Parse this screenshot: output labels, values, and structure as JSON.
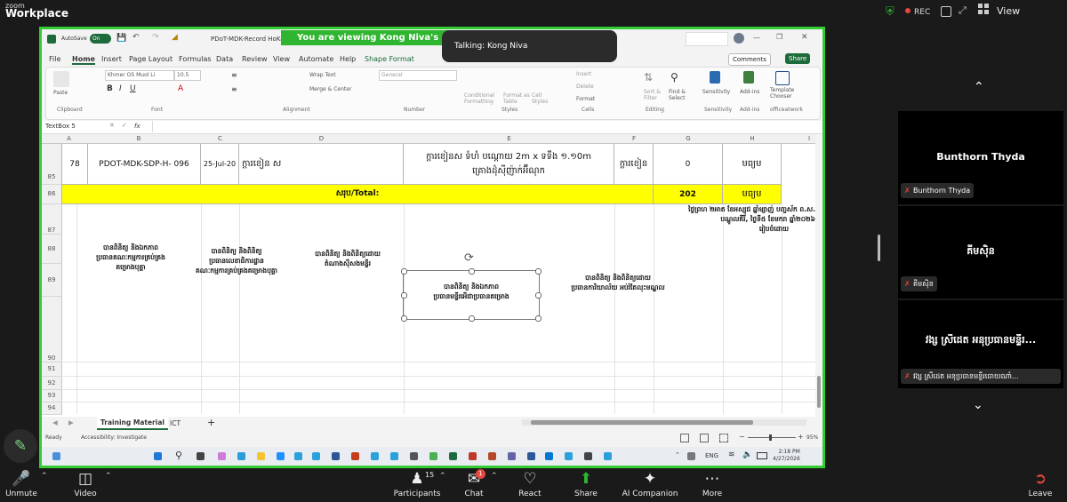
{
  "zoom": {
    "brand_small": "zoom",
    "brand": "Workplace",
    "rec_label": "REC",
    "view_label": "View",
    "viewing_banner": "You are viewing  Kong Niva's screen",
    "talking": "Talking: Kong Niva"
  },
  "excel": {
    "autosave": "AutoSave",
    "autosave_state": "On",
    "file_title": "PDoT-MDK-Record HoKa...",
    "menu": [
      "File",
      "Home",
      "Insert",
      "Page Layout",
      "Formulas",
      "Data",
      "Review",
      "View",
      "Automate",
      "Help",
      "Shape Format"
    ],
    "comments": "Comments",
    "share": "Share",
    "ribbon": {
      "paste": "Paste",
      "clipboard": "Clipboard",
      "font_name": "Khmer OS Muol Li",
      "font_size": "10.5",
      "font": "Font",
      "wrap_text": "Wrap Text",
      "merge_center": "Merge & Center",
      "alignment": "Alignment",
      "number_format": "General",
      "number": "Number",
      "conditional": "Conditional Formatting",
      "format_table": "Format as Table",
      "cell_styles": "Cell Styles",
      "styles": "Styles",
      "insert": "Insert",
      "delete": "Delete",
      "format": "Format",
      "cells": "Cells",
      "sort_filter": "Sort & Filter",
      "find_select": "Find & Select",
      "editing": "Editing",
      "sensitivity": "Sensitivity",
      "addins": "Add-ins",
      "template": "Template Chooser",
      "officeatwork": "officeatwork"
    },
    "name_box": "TextBox 5",
    "fx": "fx",
    "columns": [
      "A",
      "B",
      "C",
      "D",
      "E",
      "F",
      "G",
      "H",
      "I"
    ],
    "rows": [
      "85",
      "86",
      "87",
      "88",
      "89",
      "90",
      "91",
      "92",
      "93",
      "94"
    ],
    "row85": {
      "no": "78",
      "code": "PDOT-MDK-SDP-H- 096",
      "date": "25-Jul-20",
      "item": "ក្តារខៀន ស",
      "desc_line1": "ក្តារខៀនស ទំហំ បណ្តោយ 2m x ទទឹង ១.១0m",
      "desc_line2": "គ្រោងដុំស៊ីញ៉ាក់អ៊ីណុក",
      "unit": "ក្តារខៀន",
      "qty": "0",
      "status": "មធ្យម"
    },
    "row86": {
      "label": "សរុប/Total:",
      "total": "202",
      "status": "មធ្យម"
    },
    "signatures": {
      "date_line1": "ថ្ងៃ​ព្រហ ២អាត ខែអស្សុជ ឆ្នាំម្សាញ់ បញ្ចស័ក ព.ស.",
      "date_line2": "បណ្តូលគីរី, ថ្ងៃទី៥ ខែមករា ឆ្នាំ២០២៦",
      "date_line3": "រៀបចំដោយ",
      "s1_line1": "បានពិនិត្យ និងឯកភាព",
      "s1_line2": "ប្រធានគណៈកម្មការគ្រប់គ្រង",
      "s1_line3": "គម្រោងបុគ្គា",
      "s2_line1": "បានពិនិត្យ និងពិនិត្យ",
      "s2_line2": "ប្រធានលេខាធិការដ្ឋាន",
      "s2_line3": "គណៈកម្មការគ្រប់គ្រងគម្រោងបុគ្គា",
      "s3_line1": "បានពិនិត្យ និងពិនិត្យដោយ",
      "s3_line2": "តំណាងស៊ីសងមន្ទីរ",
      "s4_line1": "បានពិនិត្យ និងឯកភាព",
      "s4_line2": "ប្រធានមន្ទីរអើជាប្រធានគម្រោង",
      "s5_line1": "បានពិនិត្យ និងពិនិត្យដោយ",
      "s5_line2": "ប្រធានការិយាល័យ អប់រំតែលុះមណ្ឌល"
    },
    "sheets": [
      "Training Material",
      "ICT"
    ],
    "status_ready": "Ready",
    "status_access": "Accessibility: Investigate",
    "zoom_level": "95%",
    "taskbar": {
      "lang": "ENG",
      "time": "2:18 PM",
      "date": "4/27/2026"
    }
  },
  "panel": {
    "tiles": [
      {
        "name": "Bunthorn Thyda",
        "label": "Bunthorn Thyda"
      },
      {
        "name": "គីមស៊ិន",
        "label": "គីមស៊ិន"
      },
      {
        "name": "វង្ស ស្រីដេត អនុប្រធានមន្ទីរ...",
        "label": "វង្ស ស្រីដេត អនុប្រធានមន្ទីរ​ធោយណាំ..."
      }
    ]
  },
  "toolbar": {
    "unmute": "Unmute",
    "video": "Video",
    "participants": "Participants",
    "participants_count": "15",
    "chat": "Chat",
    "chat_badge": "1",
    "react": "React",
    "share": "Share",
    "ai": "AI Companion",
    "more": "More",
    "leave": "Leave"
  },
  "colors": {
    "share_border": "#33cc33",
    "total_row": "#ffff00",
    "excel_green": "#1d6b3b",
    "mute_red": "#e5483c"
  }
}
